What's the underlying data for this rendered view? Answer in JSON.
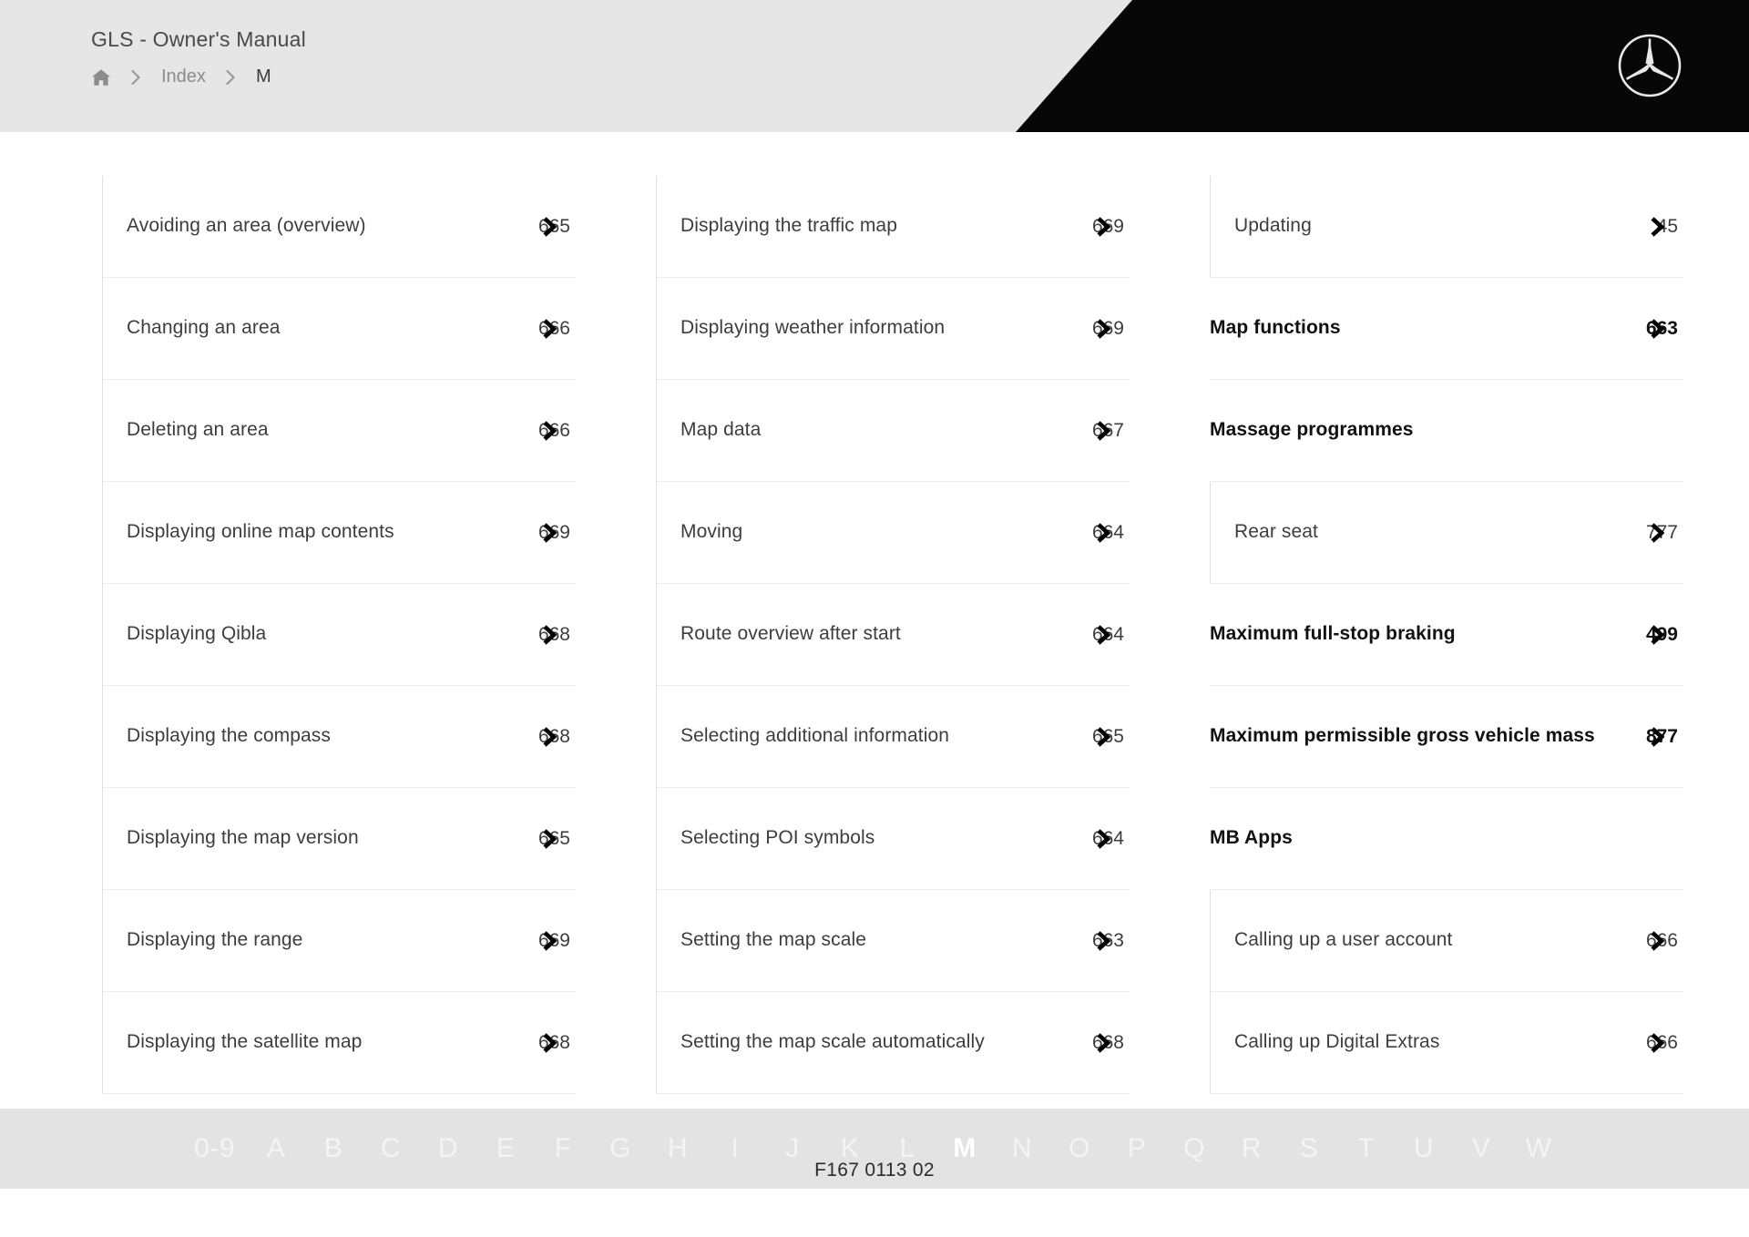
{
  "header": {
    "manual_title": "GLS - Owner's Manual",
    "breadcrumb": {
      "home_icon": "home-icon",
      "separator_icon": "chevron-right-icon",
      "items": [
        {
          "label": "Index",
          "current": false
        },
        {
          "label": "M",
          "current": true
        }
      ]
    },
    "brand_logo": "mercedes-benz-star-icon"
  },
  "index": {
    "columns": [
      {
        "entries": [
          {
            "label": "Avoiding an area (overview)",
            "page": "665",
            "level": "sub"
          },
          {
            "label": "Changing an area",
            "page": "666",
            "level": "sub"
          },
          {
            "label": "Deleting an area",
            "page": "666",
            "level": "sub"
          },
          {
            "label": "Displaying online map contents",
            "page": "669",
            "level": "sub"
          },
          {
            "label": "Displaying Qibla",
            "page": "668",
            "level": "sub"
          },
          {
            "label": "Displaying the compass",
            "page": "668",
            "level": "sub"
          },
          {
            "label": "Displaying the map version",
            "page": "665",
            "level": "sub"
          },
          {
            "label": "Displaying the range",
            "page": "669",
            "level": "sub"
          },
          {
            "label": "Displaying the satellite map",
            "page": "668",
            "level": "sub"
          }
        ]
      },
      {
        "entries": [
          {
            "label": "Displaying the traffic map",
            "page": "669",
            "level": "sub"
          },
          {
            "label": "Displaying weather information",
            "page": "669",
            "level": "sub"
          },
          {
            "label": "Map data",
            "page": "667",
            "level": "sub"
          },
          {
            "label": "Moving",
            "page": "664",
            "level": "sub"
          },
          {
            "label": "Route overview after start",
            "page": "664",
            "level": "sub"
          },
          {
            "label": "Selecting additional information",
            "page": "665",
            "level": "sub"
          },
          {
            "label": "Selecting POI symbols",
            "page": "664",
            "level": "sub"
          },
          {
            "label": "Setting the map scale",
            "page": "663",
            "level": "sub"
          },
          {
            "label": "Setting the map scale automatically",
            "page": "668",
            "level": "sub"
          }
        ]
      },
      {
        "entries": [
          {
            "label": "Updating",
            "page": "45",
            "level": "sub"
          },
          {
            "label": "Map functions",
            "page": "663",
            "level": "head"
          },
          {
            "label": "Massage programmes",
            "page": "",
            "level": "head"
          },
          {
            "label": "Rear seat",
            "page": "777",
            "level": "sub"
          },
          {
            "label": "Maximum full-stop braking",
            "page": "499",
            "level": "head"
          },
          {
            "label": "Maximum permissible gross vehicle mass",
            "page": "877",
            "level": "head"
          },
          {
            "label": "MB Apps",
            "page": "",
            "level": "head"
          },
          {
            "label": "Calling up a user account",
            "page": "666",
            "level": "sub"
          },
          {
            "label": "Calling up Digital Extras",
            "page": "666",
            "level": "sub"
          }
        ]
      }
    ]
  },
  "alphabet_bar": {
    "letters": [
      "0-9",
      "A",
      "B",
      "C",
      "D",
      "E",
      "F",
      "G",
      "H",
      "I",
      "J",
      "K",
      "L",
      "M",
      "N",
      "O",
      "P",
      "Q",
      "R",
      "S",
      "T",
      "U",
      "V",
      "W"
    ],
    "active": "M"
  },
  "footer": {
    "document_code": "F167 0113 02"
  },
  "colors": {
    "header_bg": "#e6e6e6",
    "header_accent": "#070707",
    "alphabar_bg": "#e3e3e3",
    "text": "#3d3d3d",
    "heading": "#111111",
    "divider": "#ececec"
  }
}
